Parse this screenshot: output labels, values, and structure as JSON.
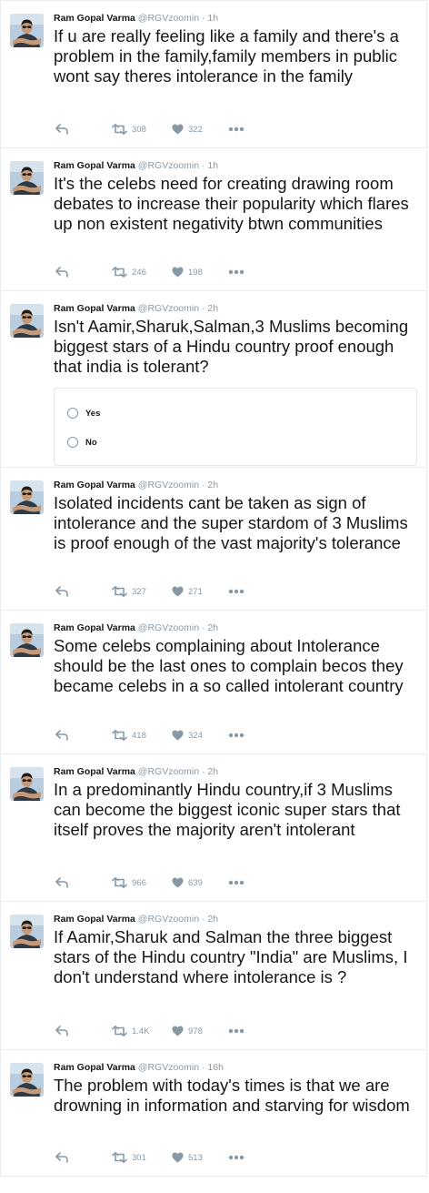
{
  "colors": {
    "text": "#14171a",
    "muted": "#8899a6",
    "border": "#e6ecf0",
    "avatar_bg": "#b8cee0"
  },
  "icons": [
    "reply-icon",
    "retweet-icon",
    "like-icon",
    "more-icon"
  ],
  "tweets": [
    {
      "name": "Ram Gopal Varma",
      "handle": "@RGVzoomin",
      "dot": "·",
      "time": "1h",
      "text": "If u are really feeling like a family and there's a problem in the family,family members in public wont say theres intolerance in the family",
      "retweets": "308",
      "likes": "322"
    },
    {
      "name": "Ram Gopal Varma",
      "handle": "@RGVzoomin",
      "dot": "·",
      "time": "1h",
      "text": "It's the celebs need for creating drawing room debates to increase their popularity which flares up non existent negativity btwn communities",
      "retweets": "246",
      "likes": "198"
    },
    {
      "name": "Ram Gopal Varma",
      "handle": "@RGVzoomin",
      "dot": "·",
      "time": "2h",
      "text": "Isn't Aamir,Sharuk,Salman,3 Muslims becoming biggest stars of a Hindu country proof enough that india is tolerant?",
      "poll": {
        "options": [
          "Yes",
          "No"
        ]
      }
    },
    {
      "name": "Ram Gopal Varma",
      "handle": "@RGVzoomin",
      "dot": "·",
      "time": "2h",
      "text": "Isolated incidents cant be taken as sign of intolerance and the super stardom of 3 Muslims is proof enough of the vast majority's tolerance",
      "retweets": "327",
      "likes": "271"
    },
    {
      "name": "Ram Gopal Varma",
      "handle": "@RGVzoomin",
      "dot": "·",
      "time": "2h",
      "text": "Some celebs complaining about Intolerance should be the last ones to complain becos they became celebs in a so called intolerant country",
      "retweets": "418",
      "likes": "324"
    },
    {
      "name": "Ram Gopal Varma",
      "handle": "@RGVzoomin",
      "dot": "·",
      "time": "2h",
      "text": "In a predominantly Hindu country,if 3 Muslims can become the biggest iconic super stars that itself proves the majority aren't intolerant",
      "retweets": "966",
      "likes": "639"
    },
    {
      "name": "Ram Gopal Varma",
      "handle": "@RGVzoomin",
      "dot": "·",
      "time": "2h",
      "text": "If Aamir,Sharuk and Salman the three biggest stars of the Hindu country \"India\" are Muslims, I don't understand where intolerance is ?",
      "retweets": "1.4K",
      "likes": "978"
    },
    {
      "name": "Ram Gopal Varma",
      "handle": "@RGVzoomin",
      "dot": "·",
      "time": "16h",
      "text": "The problem with today's times is that we are drowning in information and starving for wisdom",
      "retweets": "301",
      "likes": "513"
    }
  ]
}
